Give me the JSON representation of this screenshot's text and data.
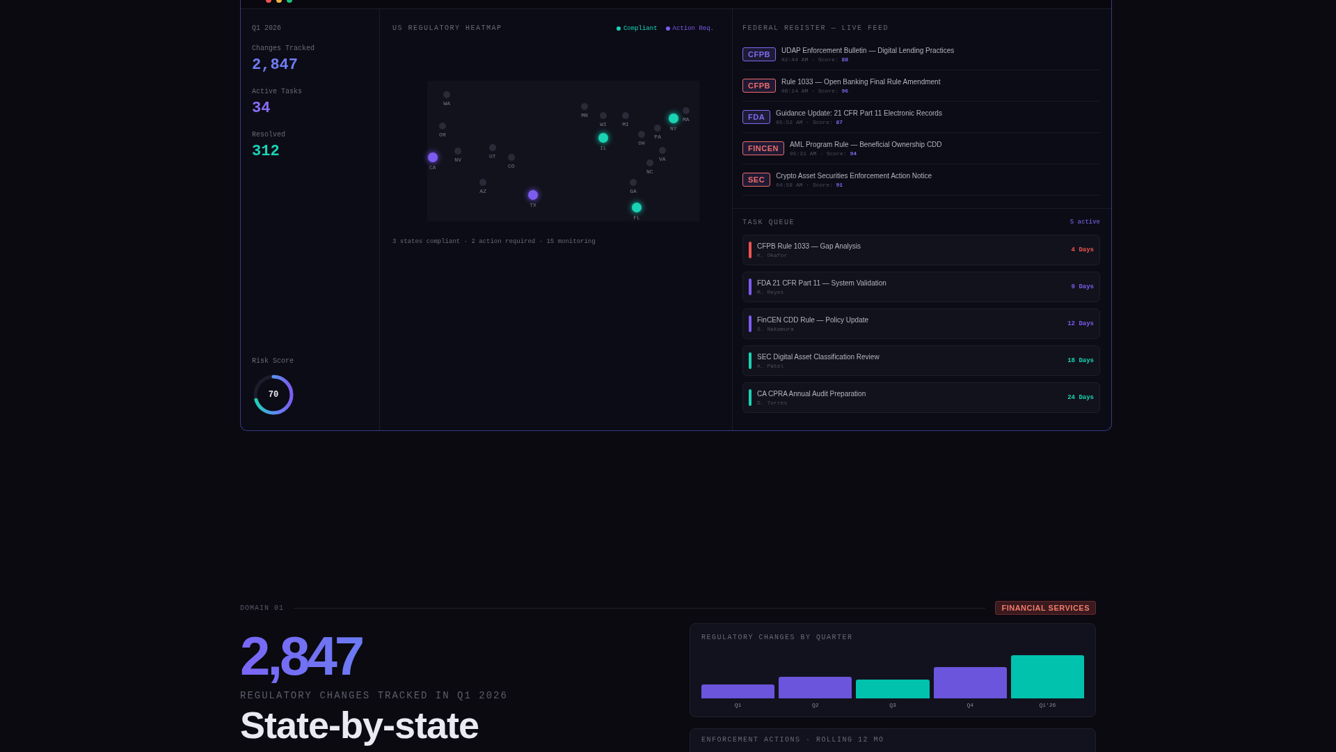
{
  "dashboard": {
    "period": "Q1 2026",
    "stats": [
      {
        "label": "Changes Tracked",
        "value": "2,847",
        "color": "#6f7cf2"
      },
      {
        "label": "Active Tasks",
        "value": "34",
        "color": "#8b6cf6"
      },
      {
        "label": "Resolved",
        "value": "312",
        "color": "#19d3b4"
      }
    ],
    "risk": {
      "label": "Risk Score",
      "value": "70"
    },
    "heatmap": {
      "title": "US REGULATORY HEATMAP",
      "legend": [
        {
          "label": "Compliant",
          "color": "#19d3b4"
        },
        {
          "label": "Action Req.",
          "color": "#7c5cf0"
        }
      ],
      "states": [
        {
          "code": "WA",
          "kind": "monitoring"
        },
        {
          "code": "OR",
          "kind": "monitoring"
        },
        {
          "code": "CA",
          "kind": "action"
        },
        {
          "code": "NV",
          "kind": "monitoring"
        },
        {
          "code": "UT",
          "kind": "monitoring"
        },
        {
          "code": "CO",
          "kind": "monitoring"
        },
        {
          "code": "AZ",
          "kind": "monitoring"
        },
        {
          "code": "TX",
          "kind": "action"
        },
        {
          "code": "MN",
          "kind": "monitoring"
        },
        {
          "code": "WI",
          "kind": "monitoring"
        },
        {
          "code": "IL",
          "kind": "compliant"
        },
        {
          "code": "MI",
          "kind": "monitoring"
        },
        {
          "code": "OH",
          "kind": "monitoring"
        },
        {
          "code": "PA",
          "kind": "monitoring"
        },
        {
          "code": "NY",
          "kind": "compliant"
        },
        {
          "code": "MA",
          "kind": "monitoring"
        },
        {
          "code": "VA",
          "kind": "monitoring"
        },
        {
          "code": "NC",
          "kind": "monitoring"
        },
        {
          "code": "GA",
          "kind": "monitoring"
        },
        {
          "code": "FL",
          "kind": "compliant"
        }
      ],
      "summary": "3 states compliant · 2 action required · 15 monitoring"
    },
    "feed": {
      "title": "FEDERAL REGISTER — LIVE FEED",
      "items": [
        {
          "agency": "CFPB",
          "color": "#7c6cf0",
          "title": "UDAP Enforcement Bulletin — Digital Lending Practices",
          "time": "02:44 AM · Score:",
          "score": "88"
        },
        {
          "agency": "CFPB",
          "color": "#f06b6b",
          "title": "Rule 1033 — Open Banking Final Rule Amendment",
          "time": "06:14 AM · Score:",
          "score": "96"
        },
        {
          "agency": "FDA",
          "color": "#7c6cf0",
          "title": "Guidance Update: 21 CFR Part 11 Electronic Records",
          "time": "05:52 AM · Score:",
          "score": "87"
        },
        {
          "agency": "FINCEN",
          "color": "#f06b6b",
          "title": "AML Program Rule — Beneficial Ownership CDD",
          "time": "05:31 AM · Score:",
          "score": "94"
        },
        {
          "agency": "SEC",
          "color": "#f06b6b",
          "title": "Crypto Asset Securities Enforcement Action Notice",
          "time": "04:58 AM · Score:",
          "score": "91"
        }
      ]
    },
    "tasks": {
      "title": "TASK QUEUE",
      "count": "5 active",
      "items": [
        {
          "title": "CFPB Rule 1033 — Gap Analysis",
          "owner": "K. Okafor",
          "due": "4 Days",
          "color": "#ef5350"
        },
        {
          "title": "FDA 21 CFR Part 11 — System Validation",
          "owner": "M. Reyes",
          "due": "9 Days",
          "color": "#7c5cf0"
        },
        {
          "title": "FinCEN CDD Rule — Policy Update",
          "owner": "S. Nakamura",
          "due": "12 Days",
          "color": "#7c5cf0"
        },
        {
          "title": "SEC Digital Asset Classification Review",
          "owner": "A. Patel",
          "due": "18 Days",
          "color": "#19d3b4"
        },
        {
          "title": "CA CPRA Annual Audit Preparation",
          "owner": "D. Torres",
          "due": "24 Days",
          "color": "#19d3b4"
        }
      ]
    }
  },
  "domain": {
    "label": "DOMAIN 01",
    "badge": "FINANCIAL SERVICES",
    "big_number": "2,847",
    "caption": "REGULATORY CHANGES TRACKED IN Q1 2026",
    "heading": "State-by-state",
    "quarter_card": {
      "title": "REGULATORY CHANGES BY QUARTER",
      "bars": [
        {
          "label": "Q1",
          "color": "#6b55dc"
        },
        {
          "label": "Q2",
          "color": "#6b55dc"
        },
        {
          "label": "Q3",
          "color": "#00c2ad"
        },
        {
          "label": "Q4",
          "color": "#6b55dc"
        },
        {
          "label": "Q1'26",
          "color": "#00c2ad"
        }
      ]
    },
    "enforcement_card": {
      "title": "ENFORCEMENT ACTIONS · ROLLING 12 MO"
    }
  }
}
